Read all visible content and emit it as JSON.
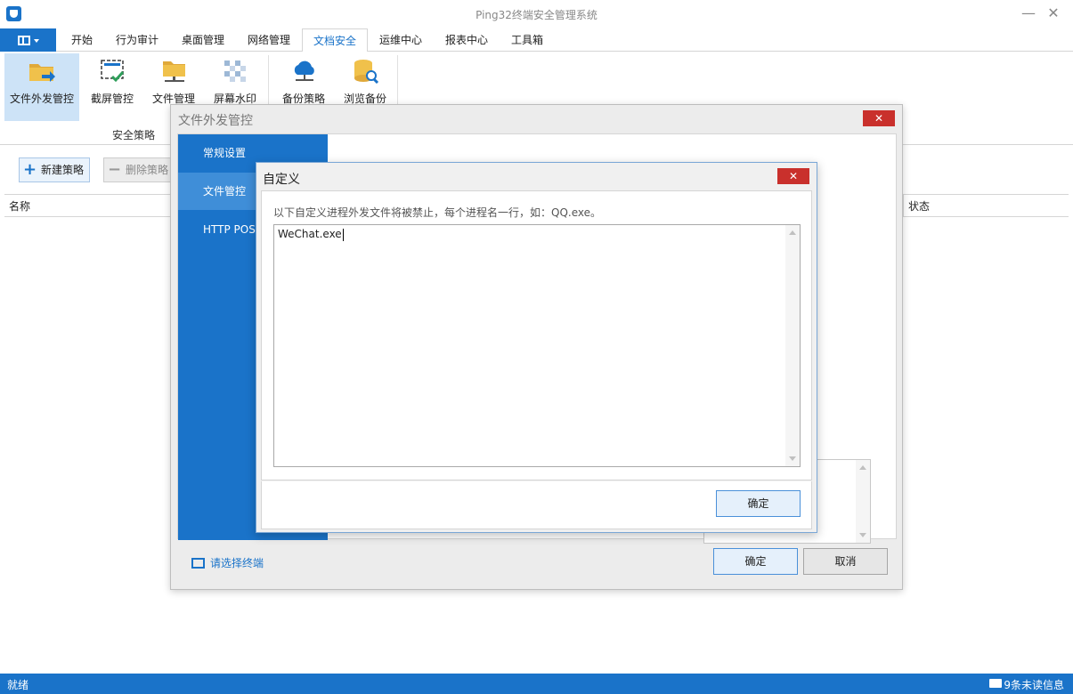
{
  "window": {
    "title": "Ping32终端安全管理系统",
    "minimize_glyph": "—",
    "close_glyph": "✕"
  },
  "ribbon_tabs": [
    {
      "label": "开始"
    },
    {
      "label": "行为审计"
    },
    {
      "label": "桌面管理"
    },
    {
      "label": "网络管理"
    },
    {
      "label": "文档安全",
      "active": true
    },
    {
      "label": "运维中心"
    },
    {
      "label": "报表中心"
    },
    {
      "label": "工具箱"
    }
  ],
  "ribbon": {
    "buttons": [
      {
        "label": "文件外发管控",
        "icon": "folder-send-icon",
        "selected": true
      },
      {
        "label": "截屏管控",
        "icon": "screenshot-check-icon"
      },
      {
        "label": "文件管理",
        "icon": "folder-network-icon"
      },
      {
        "label": "屏幕水印",
        "icon": "watermark-icon"
      },
      {
        "label": "备份策略",
        "icon": "cloud-backup-icon"
      },
      {
        "label": "浏览备份",
        "icon": "database-search-icon"
      }
    ],
    "group_label": "安全策略"
  },
  "main": {
    "new_policy_label": "新建策略",
    "delete_policy_label": "删除策略",
    "columns": {
      "name": "名称",
      "status": "状态"
    }
  },
  "dialog_file_send": {
    "title": "文件外发管控",
    "close_glyph": "✕",
    "nav": [
      {
        "label": "常规设置"
      },
      {
        "label": "文件管控",
        "active": true
      },
      {
        "label": "HTTP POS"
      }
    ],
    "select_terminal_label": "请选择终端",
    "ok_label": "确定",
    "cancel_label": "取消"
  },
  "dialog_custom": {
    "title": "自定义",
    "close_glyph": "✕",
    "hint": "以下自定义进程外发文件将被禁止，每个进程名一行，如：QQ.exe。",
    "textarea_value": "WeChat.exe",
    "ok_label": "确定"
  },
  "statusbar": {
    "left": "就绪",
    "right": "9条未读信息"
  },
  "colors": {
    "accent": "#1a73c9",
    "close_red": "#c9302c",
    "ribbon_selected": "#cde3f7"
  }
}
